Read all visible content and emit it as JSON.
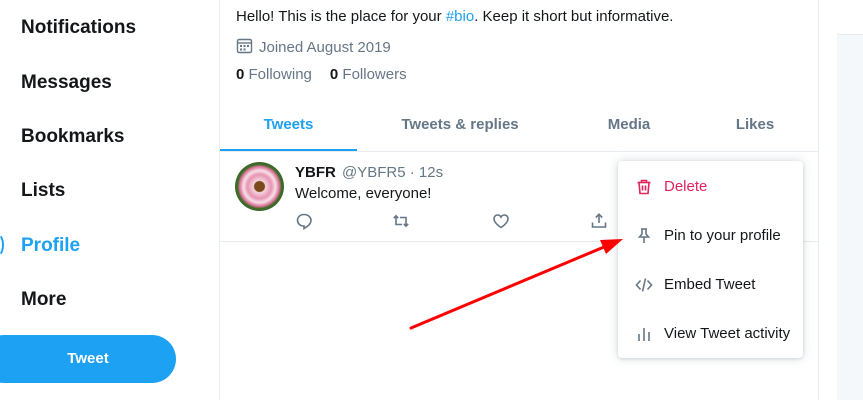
{
  "nav": {
    "items": [
      {
        "label": "Notifications"
      },
      {
        "label": "Messages"
      },
      {
        "label": "Bookmarks"
      },
      {
        "label": "Lists"
      },
      {
        "label": "Profile"
      },
      {
        "label": "More"
      }
    ],
    "tweet_button": "Tweet"
  },
  "profile": {
    "bio_prefix": "Hello! This is the place for your ",
    "bio_hashtag": "#bio",
    "bio_suffix": ". Keep it short but informative.",
    "joined": "Joined August 2019",
    "following_count": "0",
    "following_label": "Following",
    "followers_count": "0",
    "followers_label": "Followers"
  },
  "tabs": [
    {
      "label": "Tweets"
    },
    {
      "label": "Tweets & replies"
    },
    {
      "label": "Media"
    },
    {
      "label": "Likes"
    }
  ],
  "tweet": {
    "name": "YBFR",
    "handle_time": "@YBFR5 · 12s",
    "text": "Welcome, everyone!"
  },
  "menu": {
    "items": [
      {
        "label": "Delete",
        "icon": "trash-icon"
      },
      {
        "label": "Pin to your profile",
        "icon": "pin-icon"
      },
      {
        "label": "Embed Tweet",
        "icon": "code-icon"
      },
      {
        "label": "View Tweet activity",
        "icon": "analytics-icon"
      }
    ]
  },
  "colors": {
    "accent": "#1da1f2",
    "danger": "#e0245e",
    "muted": "#657786",
    "annotation": "#ff0000"
  }
}
